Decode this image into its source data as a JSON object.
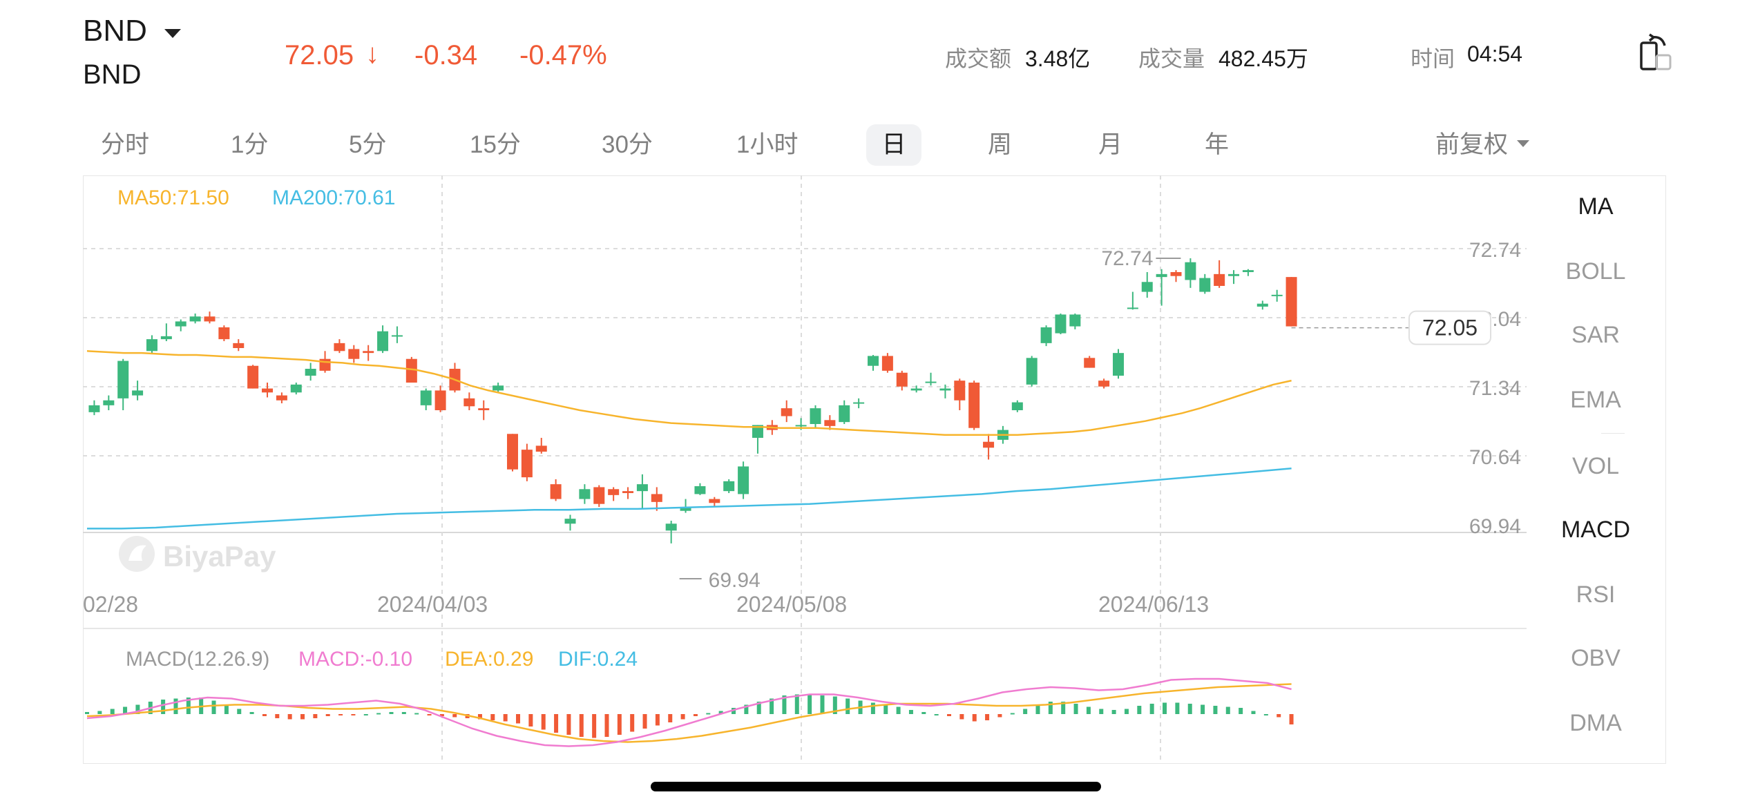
{
  "header": {
    "ticker": "BND",
    "subname": "BND",
    "price": "72.05",
    "arrow": "↓",
    "change": "-0.34",
    "change_pct": "-0.47%",
    "turnover_label": "成交额",
    "turnover_value": "3.48亿",
    "volume_label": "成交量",
    "volume_value": "482.45万",
    "time_label": "时间",
    "time_value": "04:54"
  },
  "tabs": [
    "分时",
    "1分",
    "5分",
    "15分",
    "30分",
    "1小时",
    "日",
    "周",
    "月",
    "年"
  ],
  "active_tab": "日",
  "adjust_label": "前复权",
  "indicators": [
    {
      "label": "MA",
      "active": true
    },
    {
      "label": "BOLL",
      "active": false
    },
    {
      "label": "SAR",
      "active": false
    },
    {
      "label": "EMA",
      "active": false
    },
    {
      "label": "VOL",
      "active": false
    },
    {
      "label": "MACD",
      "active": true
    },
    {
      "label": "RSI",
      "active": false
    },
    {
      "label": "OBV",
      "active": false
    },
    {
      "label": "DMA",
      "active": false
    }
  ],
  "watermark": "BiyaPay",
  "colors": {
    "up": "#3cb87e",
    "down": "#f05a36",
    "ma50": "#f7b42c",
    "ma200": "#44bde3",
    "macd": "#f07cd0"
  },
  "chart_data": [
    {
      "type": "candlestick",
      "legend": {
        "ma50": "MA50:71.50",
        "ma200": "MA200:70.61"
      },
      "y_ticks": [
        "72.74",
        "72.04",
        "71.34",
        "70.64",
        "69.94"
      ],
      "ylim": [
        69.94,
        72.74
      ],
      "x_ticks": [
        "02/28",
        "2024/04/03",
        "2024/05/08",
        "2024/06/13"
      ],
      "high_label": "72.74",
      "low_label": "69.94",
      "last_price_label": "72.05",
      "candles": [
        [
          71.18,
          71.3,
          71.15,
          71.25
        ],
        [
          71.25,
          71.35,
          71.2,
          71.3
        ],
        [
          71.32,
          71.72,
          71.2,
          71.7
        ],
        [
          71.35,
          71.5,
          71.3,
          71.4
        ],
        [
          71.8,
          71.96,
          71.78,
          71.92
        ],
        [
          71.92,
          72.08,
          71.9,
          71.95
        ],
        [
          72.05,
          72.12,
          72.0,
          72.1
        ],
        [
          72.1,
          72.18,
          72.08,
          72.15
        ],
        [
          72.15,
          72.2,
          72.08,
          72.1
        ],
        [
          72.04,
          72.06,
          71.9,
          71.92
        ],
        [
          71.88,
          71.92,
          71.8,
          71.83
        ],
        [
          71.65,
          71.66,
          71.42,
          71.42
        ],
        [
          71.42,
          71.48,
          71.33,
          71.38
        ],
        [
          71.35,
          71.38,
          71.27,
          71.3
        ],
        [
          71.38,
          71.48,
          71.36,
          71.46
        ],
        [
          71.55,
          71.68,
          71.5,
          71.62
        ],
        [
          71.72,
          71.8,
          71.58,
          71.6
        ],
        [
          71.88,
          71.92,
          71.78,
          71.8
        ],
        [
          71.82,
          71.86,
          71.68,
          71.72
        ],
        [
          71.8,
          71.86,
          71.7,
          71.78
        ],
        [
          71.8,
          72.06,
          71.78,
          72.0
        ],
        [
          71.96,
          72.05,
          71.88,
          71.96
        ],
        [
          71.72,
          71.74,
          71.48,
          71.48
        ],
        [
          71.25,
          71.42,
          71.2,
          71.4
        ],
        [
          71.4,
          71.45,
          71.18,
          71.2
        ],
        [
          71.62,
          71.68,
          71.38,
          71.4
        ],
        [
          71.32,
          71.38,
          71.2,
          71.24
        ],
        [
          71.22,
          71.3,
          71.1,
          71.2
        ],
        [
          71.4,
          71.48,
          71.38,
          71.45
        ],
        [
          70.96,
          70.96,
          70.58,
          70.6
        ],
        [
          70.8,
          70.86,
          70.48,
          70.52
        ],
        [
          70.84,
          70.92,
          70.76,
          70.78
        ],
        [
          70.45,
          70.5,
          70.28,
          70.3
        ],
        [
          70.05,
          70.14,
          69.98,
          70.1
        ],
        [
          70.3,
          70.45,
          70.25,
          70.4
        ],
        [
          70.42,
          70.44,
          70.22,
          70.25
        ],
        [
          70.4,
          70.42,
          70.28,
          70.34
        ],
        [
          70.38,
          70.42,
          70.3,
          70.36
        ],
        [
          70.38,
          70.55,
          70.2,
          70.45
        ],
        [
          70.35,
          70.42,
          70.18,
          70.27
        ],
        [
          69.98,
          70.08,
          69.85,
          70.05
        ],
        [
          70.18,
          70.3,
          70.16,
          70.22
        ],
        [
          70.35,
          70.46,
          70.34,
          70.43
        ],
        [
          70.3,
          70.32,
          70.22,
          70.26
        ],
        [
          70.38,
          70.5,
          70.36,
          70.48
        ],
        [
          70.35,
          70.68,
          70.3,
          70.63
        ],
        [
          70.92,
          71.05,
          70.76,
          71.05
        ],
        [
          71.05,
          71.1,
          70.95,
          71.0
        ],
        [
          71.22,
          71.3,
          71.08,
          71.14
        ],
        [
          71.05,
          71.12,
          71.0,
          71.05
        ],
        [
          71.06,
          71.25,
          71.02,
          71.22
        ],
        [
          71.1,
          71.15,
          71.0,
          71.04
        ],
        [
          71.08,
          71.3,
          71.06,
          71.25
        ],
        [
          71.27,
          71.32,
          71.22,
          71.28
        ],
        [
          71.65,
          71.76,
          71.6,
          71.75
        ],
        [
          71.75,
          71.78,
          71.58,
          71.6
        ],
        [
          71.58,
          71.6,
          71.4,
          71.44
        ],
        [
          71.4,
          71.45,
          71.38,
          71.42
        ],
        [
          71.48,
          71.58,
          71.45,
          71.49
        ],
        [
          71.4,
          71.46,
          71.32,
          71.42
        ],
        [
          71.5,
          71.52,
          71.2,
          71.3
        ],
        [
          71.48,
          71.5,
          71.0,
          71.02
        ],
        [
          70.88,
          70.96,
          70.7,
          70.82
        ],
        [
          70.9,
          71.04,
          70.86,
          71.0
        ],
        [
          71.2,
          71.3,
          71.18,
          71.28
        ],
        [
          71.46,
          71.75,
          71.44,
          71.73
        ],
        [
          71.88,
          72.06,
          71.85,
          72.04
        ],
        [
          71.98,
          72.18,
          71.97,
          72.17
        ],
        [
          72.05,
          72.18,
          72.02,
          72.17
        ],
        [
          71.73,
          71.75,
          71.63,
          71.63
        ],
        [
          71.5,
          71.52,
          71.42,
          71.44
        ],
        [
          71.55,
          71.82,
          71.52,
          71.78
        ],
        [
          72.24,
          72.4,
          72.22,
          72.24
        ],
        [
          72.4,
          72.6,
          72.34,
          72.5
        ],
        [
          72.55,
          72.63,
          72.26,
          72.58
        ],
        [
          72.6,
          72.62,
          72.5,
          72.56
        ],
        [
          72.52,
          72.74,
          72.44,
          72.7
        ],
        [
          72.4,
          72.58,
          72.38,
          72.54
        ],
        [
          72.58,
          72.72,
          72.44,
          72.46
        ],
        [
          72.56,
          72.62,
          72.48,
          72.58
        ],
        [
          72.6,
          72.63,
          72.56,
          72.62
        ],
        [
          72.25,
          72.31,
          72.22,
          72.28
        ],
        [
          72.37,
          72.42,
          72.3,
          72.37
        ],
        [
          72.55,
          72.55,
          72.05,
          72.05
        ]
      ],
      "ma50": [
        71.8,
        71.79,
        71.78,
        71.78,
        71.77,
        71.76,
        71.76,
        71.75,
        71.74,
        71.74,
        71.73,
        71.72,
        71.71,
        71.69,
        71.68,
        71.66,
        71.65,
        71.63,
        71.61,
        71.57,
        71.52,
        71.45,
        71.4,
        71.36,
        71.32,
        71.28,
        71.24,
        71.2,
        71.17,
        71.14,
        71.11,
        71.09,
        71.07,
        71.06,
        71.05,
        71.04,
        71.03,
        71.03,
        71.02,
        71.02,
        71.02,
        71.01,
        71.0,
        70.99,
        70.98,
        70.97,
        70.96,
        70.95,
        70.95,
        70.95,
        70.95,
        70.95,
        70.96,
        70.97,
        70.98,
        71.0,
        71.03,
        71.06,
        71.09,
        71.13,
        71.17,
        71.22,
        71.28,
        71.34,
        71.4,
        71.46,
        71.5
      ],
      "ma200": [
        70.0,
        70.0,
        70.01,
        70.03,
        70.05,
        70.07,
        70.09,
        70.11,
        70.13,
        70.15,
        70.16,
        70.17,
        70.18,
        70.19,
        70.19,
        70.2,
        70.2,
        70.21,
        70.22,
        70.23,
        70.24,
        70.25,
        70.27,
        70.29,
        70.31,
        70.33,
        70.35,
        70.38,
        70.4,
        70.43,
        70.46,
        70.49,
        70.52,
        70.55,
        70.58,
        70.61
      ]
    },
    {
      "type": "bar+line",
      "legend": {
        "title": "MACD(12.26.9)",
        "macd": "MACD:-0.10",
        "dea": "DEA:0.29",
        "dif": "DIF:0.24"
      },
      "ylim": [
        -0.4,
        0.6
      ],
      "macd": [
        0.02,
        0.03,
        0.05,
        0.07,
        0.09,
        0.12,
        0.14,
        0.15,
        0.16,
        0.16,
        0.13,
        0.09,
        0.05,
        0.02,
        -0.02,
        -0.04,
        -0.05,
        -0.05,
        -0.04,
        -0.02,
        -0.01,
        -0.01,
        0.0,
        0.01,
        0.02,
        0.02,
        0.01,
        -0.01,
        -0.02,
        -0.03,
        -0.04,
        -0.05,
        -0.06,
        -0.07,
        -0.09,
        -0.12,
        -0.15,
        -0.18,
        -0.2,
        -0.22,
        -0.23,
        -0.22,
        -0.2,
        -0.17,
        -0.14,
        -0.11,
        -0.08,
        -0.05,
        -0.02,
        0.01,
        0.03,
        0.06,
        0.09,
        0.12,
        0.15,
        0.18,
        0.19,
        0.19,
        0.18,
        0.17,
        0.15,
        0.13,
        0.11,
        0.09,
        0.07,
        0.04,
        0.02,
        0.0,
        -0.02,
        -0.05,
        -0.07,
        -0.06,
        -0.03,
        0.01,
        0.05,
        0.09,
        0.12,
        0.12,
        0.1,
        0.07,
        0.05,
        0.04,
        0.05,
        0.08,
        0.1,
        0.11,
        0.11,
        0.1,
        0.09,
        0.08,
        0.07,
        0.06,
        0.03,
        0.0,
        -0.03,
        -0.1
      ],
      "dea": [
        -0.02,
        -0.01,
        0.01,
        0.03,
        0.06,
        0.08,
        0.09,
        0.09,
        0.08,
        0.06,
        0.05,
        0.05,
        0.06,
        0.07,
        0.05,
        0.01,
        -0.04,
        -0.1,
        -0.15,
        -0.2,
        -0.24,
        -0.26,
        -0.27,
        -0.26,
        -0.24,
        -0.21,
        -0.17,
        -0.13,
        -0.08,
        -0.03,
        0.01,
        0.05,
        0.08,
        0.1,
        0.1,
        0.1,
        0.09,
        0.08,
        0.08,
        0.09,
        0.11,
        0.14,
        0.17,
        0.2,
        0.22,
        0.24,
        0.26,
        0.27,
        0.28,
        0.29
      ],
      "dif": [
        -0.04,
        -0.02,
        0.02,
        0.08,
        0.13,
        0.16,
        0.15,
        0.11,
        0.08,
        0.08,
        0.09,
        0.11,
        0.13,
        0.1,
        0.04,
        -0.05,
        -0.14,
        -0.21,
        -0.26,
        -0.3,
        -0.31,
        -0.3,
        -0.27,
        -0.22,
        -0.16,
        -0.09,
        -0.02,
        0.05,
        0.11,
        0.16,
        0.19,
        0.19,
        0.16,
        0.12,
        0.09,
        0.08,
        0.1,
        0.15,
        0.21,
        0.24,
        0.26,
        0.25,
        0.23,
        0.24,
        0.28,
        0.33,
        0.34,
        0.34,
        0.32,
        0.3,
        0.24
      ]
    }
  ]
}
